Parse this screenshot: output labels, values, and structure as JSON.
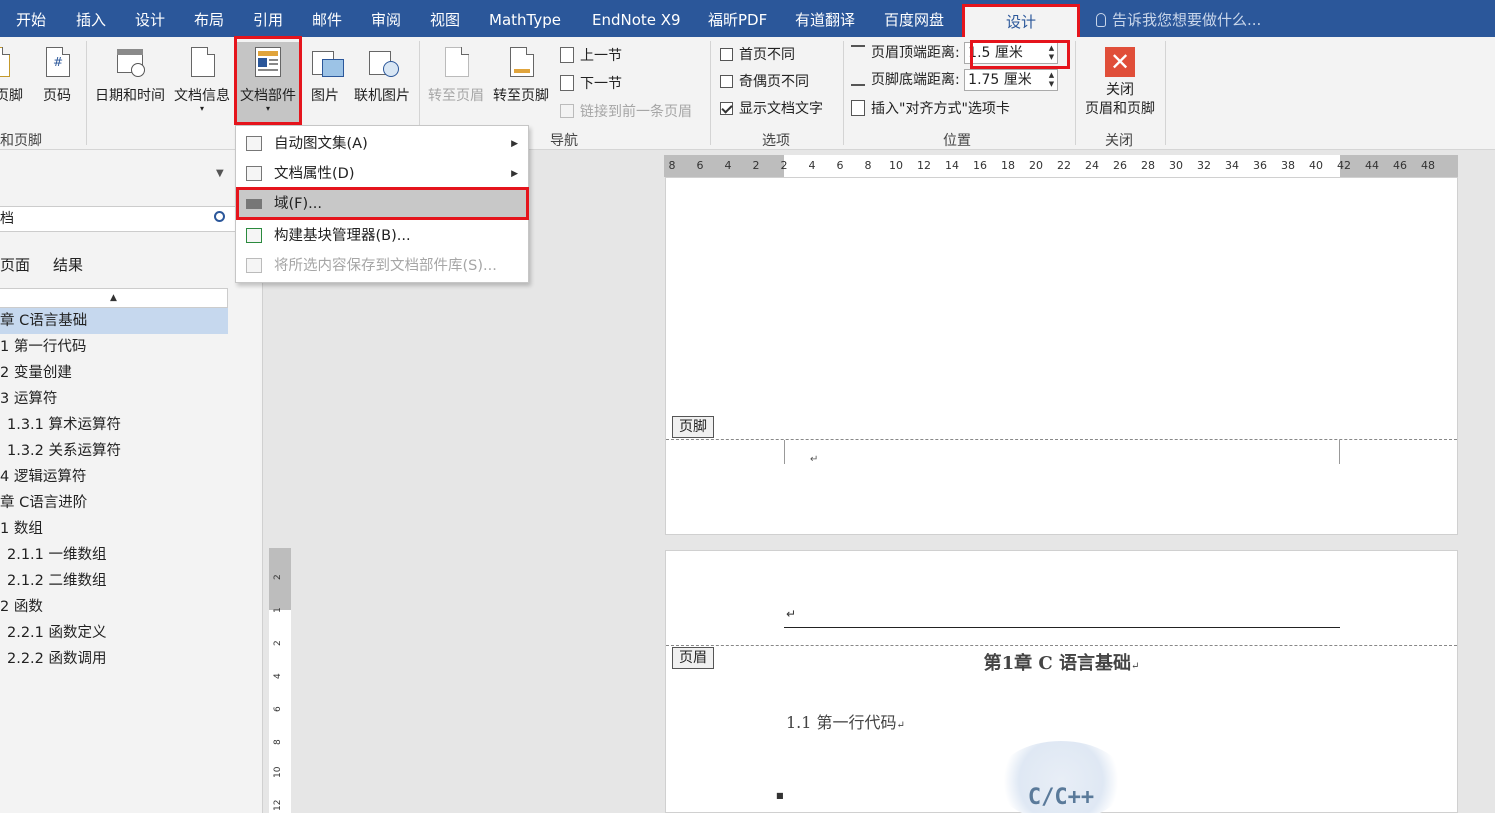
{
  "tabs": [
    "开始",
    "插入",
    "设计",
    "布局",
    "引用",
    "邮件",
    "审阅",
    "视图",
    "MathType",
    "EndNote X9",
    "福昕PDF",
    "有道翻译",
    "百度网盘"
  ],
  "active_tab": "设计",
  "tell_me": "告诉我您想要做什么...",
  "ribbon": {
    "header_footer_btn": "页脚",
    "page_number_btn": "页码",
    "group_header_footer": "和页脚",
    "date_time_btn": "日期和时间",
    "doc_info_btn": "文档信息",
    "quick_parts_btn": "文档部件",
    "picture_btn": "图片",
    "online_picture_btn": "联机图片",
    "goto_header_btn": "转至页眉",
    "goto_footer_btn": "转至页脚",
    "prev_section": "上一节",
    "next_section": "下一节",
    "link_previous": "链接到前一条页眉",
    "group_nav": "导航",
    "diff_first_page": "首页不同",
    "diff_odd_even": "奇偶页不同",
    "show_doc_text": "显示文档文字",
    "group_options": "选项",
    "header_top_label": "页眉顶端距离:",
    "header_top_value": "1.5 厘米",
    "footer_bottom_label": "页脚底端距离:",
    "footer_bottom_value": "1.75 厘米",
    "insert_align_tab": "插入\"对齐方式\"选项卡",
    "group_position": "位置",
    "close_line1": "关闭",
    "close_line2": "页眉和页脚",
    "group_close": "关闭"
  },
  "dropdown": {
    "items": [
      {
        "label": "自动图文集(A)",
        "submenu": true,
        "disabled": false
      },
      {
        "label": "文档属性(D)",
        "submenu": true,
        "disabled": false
      },
      {
        "label": "域(F)...",
        "submenu": false,
        "disabled": false
      },
      {
        "label": "构建基块管理器(B)...",
        "submenu": false,
        "disabled": false
      },
      {
        "label": "将所选内容保存到文档部件库(S)...",
        "submenu": false,
        "disabled": true
      }
    ]
  },
  "nav": {
    "search_text": "档",
    "tab_pages": "页面",
    "tab_results": "结果",
    "tree": [
      "章 C语言基础",
      "1 第一行代码",
      "2 变量创建",
      "3 运算符",
      "1.3.1 算术运算符",
      "1.3.2 关系运算符",
      "4 逻辑运算符",
      "章 C语言进阶",
      "1 数组",
      "2.1.1 一维数组",
      "2.1.2 二维数组",
      "2 函数",
      "2.2.1 函数定义",
      "2.2.2 函数调用"
    ]
  },
  "hruler_numbers": [
    "8",
    "6",
    "4",
    "2",
    "2",
    "4",
    "6",
    "8",
    "10",
    "12",
    "14",
    "16",
    "18",
    "20",
    "22",
    "24",
    "26",
    "28",
    "30",
    "32",
    "34",
    "36",
    "38",
    "40",
    "42",
    "44",
    "46",
    "48"
  ],
  "vruler_numbers": [
    "2",
    "1",
    "2",
    "4",
    "6",
    "8",
    "10",
    "12"
  ],
  "document": {
    "footer_tag": "页脚",
    "header_tag": "页眉",
    "chapter_title": "第1章  C 语言基础",
    "section_title": "1.1 第一行代码",
    "logo_text": "C/C++"
  },
  "colors": {
    "accent": "#2b579a",
    "highlight": "#e5141c",
    "close_x": "#e04e39"
  }
}
